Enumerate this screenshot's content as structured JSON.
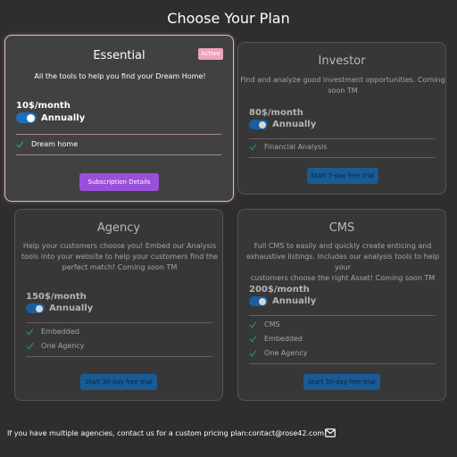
{
  "page": {
    "title": "Choose Your Plan"
  },
  "plans": [
    {
      "name": "Essential",
      "badge": "Active",
      "description": "All the tools to help you find your Dream Home!",
      "price": "10$/month",
      "billing": "Annually",
      "billing_toggle_on": true,
      "features": [
        "Dream home"
      ],
      "button": "Subscription Details"
    },
    {
      "name": "Investor",
      "description_lines": [
        "Find and analyze good investment opportunities. Coming",
        "soon TM"
      ],
      "price": "80$/month",
      "billing": "Annually",
      "billing_toggle_on": true,
      "features": [
        "Financial Analysis"
      ],
      "button": "Start 7-day free trial"
    },
    {
      "name": "Agency",
      "description_lines": [
        "Help your customers choose you! Embed our Analysis",
        "tools into your website to help your customers find the",
        "perfect match! Coming soon TM"
      ],
      "price": "150$/month",
      "billing": "Annually",
      "billing_toggle_on": true,
      "features": [
        "Embedded",
        "One Agency"
      ],
      "button": "Start 30-day free trial"
    },
    {
      "name": "CMS",
      "description_lines": [
        "Full CMS to easily and quickly create enticing and",
        "exhaustive listings. Includes our analysis tools to help your",
        "customers choose the right Asset! Coming soon TM"
      ],
      "price": "200$/month",
      "billing": "Annually",
      "billing_toggle_on": true,
      "features": [
        "CMS",
        "Embedded",
        "One Agency"
      ],
      "button": "Start 30-day free trial"
    }
  ],
  "footer": {
    "text": "If you have multiple agencies, contact us for a custom pricing plan:contact@rose42.com"
  },
  "icons": {
    "check": "check-icon",
    "mail": "mail-icon"
  },
  "colors": {
    "background": "#2e2e2e",
    "card": "#373737",
    "active_border": "#e8b7c0",
    "badge": "#f0a2ba",
    "toggle": "#1e6fb8",
    "check": "#2ea84a",
    "purple_button": "#9a4fd8",
    "blue_button": "#195c95"
  }
}
